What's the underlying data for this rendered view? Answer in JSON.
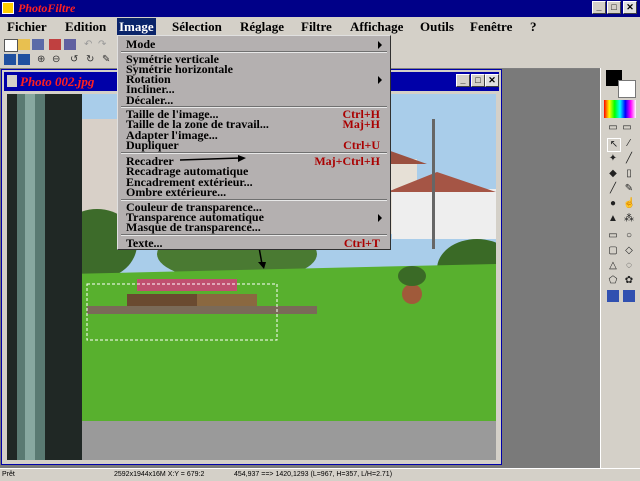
{
  "window": {
    "title": "PhotoFiltre"
  },
  "menubar": {
    "items": [
      {
        "label": "Fichier"
      },
      {
        "label": "Edition"
      },
      {
        "label": "Image"
      },
      {
        "label": "Sélection"
      },
      {
        "label": "Réglage"
      },
      {
        "label": "Filtre"
      },
      {
        "label": "Affichage"
      },
      {
        "label": "Outils"
      },
      {
        "label": "Fenêtre"
      },
      {
        "label": "?"
      }
    ]
  },
  "image_menu": {
    "items": [
      {
        "label": "Mode",
        "shortcut": ""
      },
      {
        "label": "Symétrie verticale",
        "shortcut": ""
      },
      {
        "label": "Symétrie horizontale",
        "shortcut": ""
      },
      {
        "label": "Rotation",
        "shortcut": ""
      },
      {
        "label": "Incliner...",
        "shortcut": ""
      },
      {
        "label": "Décaler...",
        "shortcut": ""
      },
      {
        "label": "Taille de l'image...",
        "shortcut": "Ctrl+H"
      },
      {
        "label": "Taille de la zone de travail...",
        "shortcut": "Maj+H"
      },
      {
        "label": "Adapter l'image...",
        "shortcut": ""
      },
      {
        "label": "Dupliquer",
        "shortcut": "Ctrl+U"
      },
      {
        "label": "Recadrer",
        "shortcut": "Maj+Ctrl+H"
      },
      {
        "label": "Recadrage automatique",
        "shortcut": ""
      },
      {
        "label": "Encadrement extérieur...",
        "shortcut": ""
      },
      {
        "label": "Ombre extérieure...",
        "shortcut": ""
      },
      {
        "label": "Couleur de transparence...",
        "shortcut": ""
      },
      {
        "label": "Transparence automatique",
        "shortcut": ""
      },
      {
        "label": "Masque de transparence...",
        "shortcut": ""
      },
      {
        "label": "Texte...",
        "shortcut": "Ctrl+T"
      }
    ]
  },
  "child_window": {
    "title": "Photo 002.jpg"
  },
  "statusbar": {
    "state": "Prêt",
    "image_info": "2592x1944x16M  X:Y = 679:2",
    "selection_info": "454,937 ==> 1420,1293 (L=967, H=357, L/H=2.71)"
  },
  "colors": {
    "menu_highlight": "#0a246a",
    "shortcut": "#aa0000",
    "titlebar": "#000088",
    "app_title": "#ff2020"
  }
}
